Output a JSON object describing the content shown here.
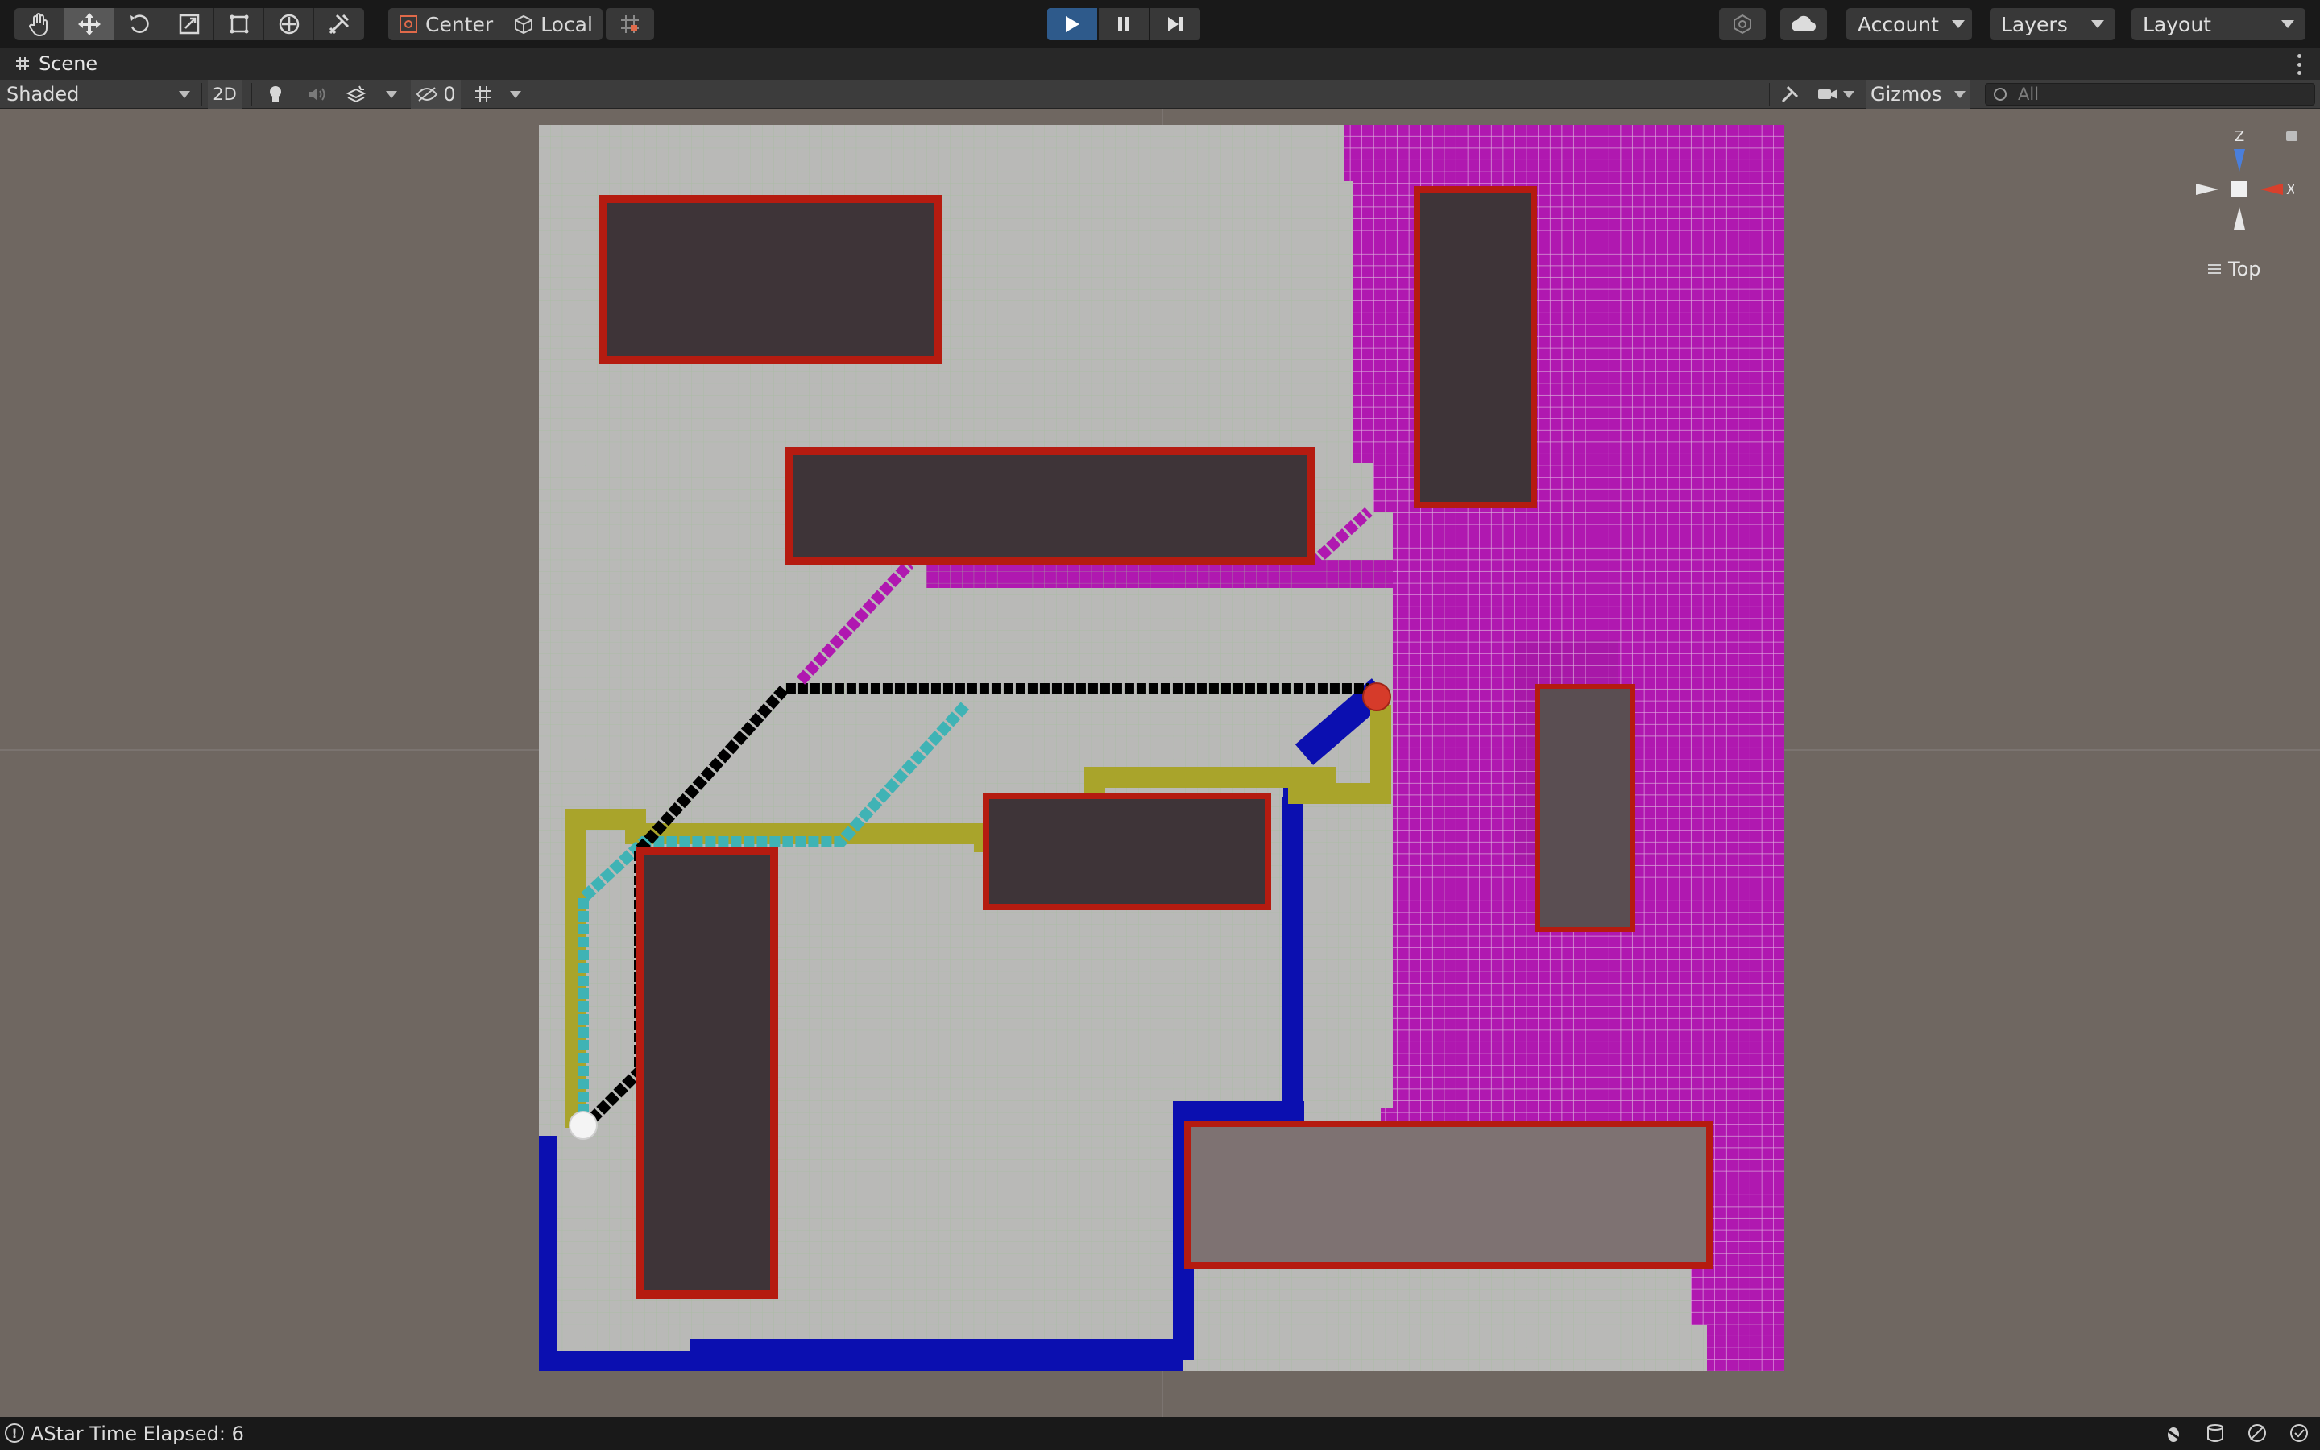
{
  "toolbar": {
    "tools": [
      "hand-tool",
      "move-tool",
      "rotate-tool",
      "scale-tool",
      "rect-tool",
      "transform-tool",
      "custom-tool"
    ],
    "active_tool": "move-tool",
    "pivot_label": "Center",
    "space_label": "Local",
    "account_label": "Account",
    "layers_label": "Layers",
    "layout_label": "Layout"
  },
  "tab": {
    "label": "Scene"
  },
  "scene_toolbar": {
    "shading_label": "Shaded",
    "mode_2d_label": "2D",
    "hidden_count": "0",
    "gizmos_label": "Gizmos",
    "search_placeholder": "All"
  },
  "gizmo": {
    "y_axis": "Z",
    "x_axis": "X",
    "view_label": "Top"
  },
  "status": {
    "message": "AStar Time Elapsed: 6"
  },
  "colors": {
    "accent_play": "#2e5a8b",
    "path_black": "#000000",
    "path_yellow": "#a7a22a",
    "path_teal": "#3fb2b4",
    "path_blue": "#0b0fb0",
    "region_magenta": "#b019b0",
    "obstacle_fill": "#3f3438",
    "obstacle_border": "#b51c10",
    "ground": "#b8b8b6",
    "start_ball": "#ffffff",
    "goal_ball": "#d83a2a"
  }
}
